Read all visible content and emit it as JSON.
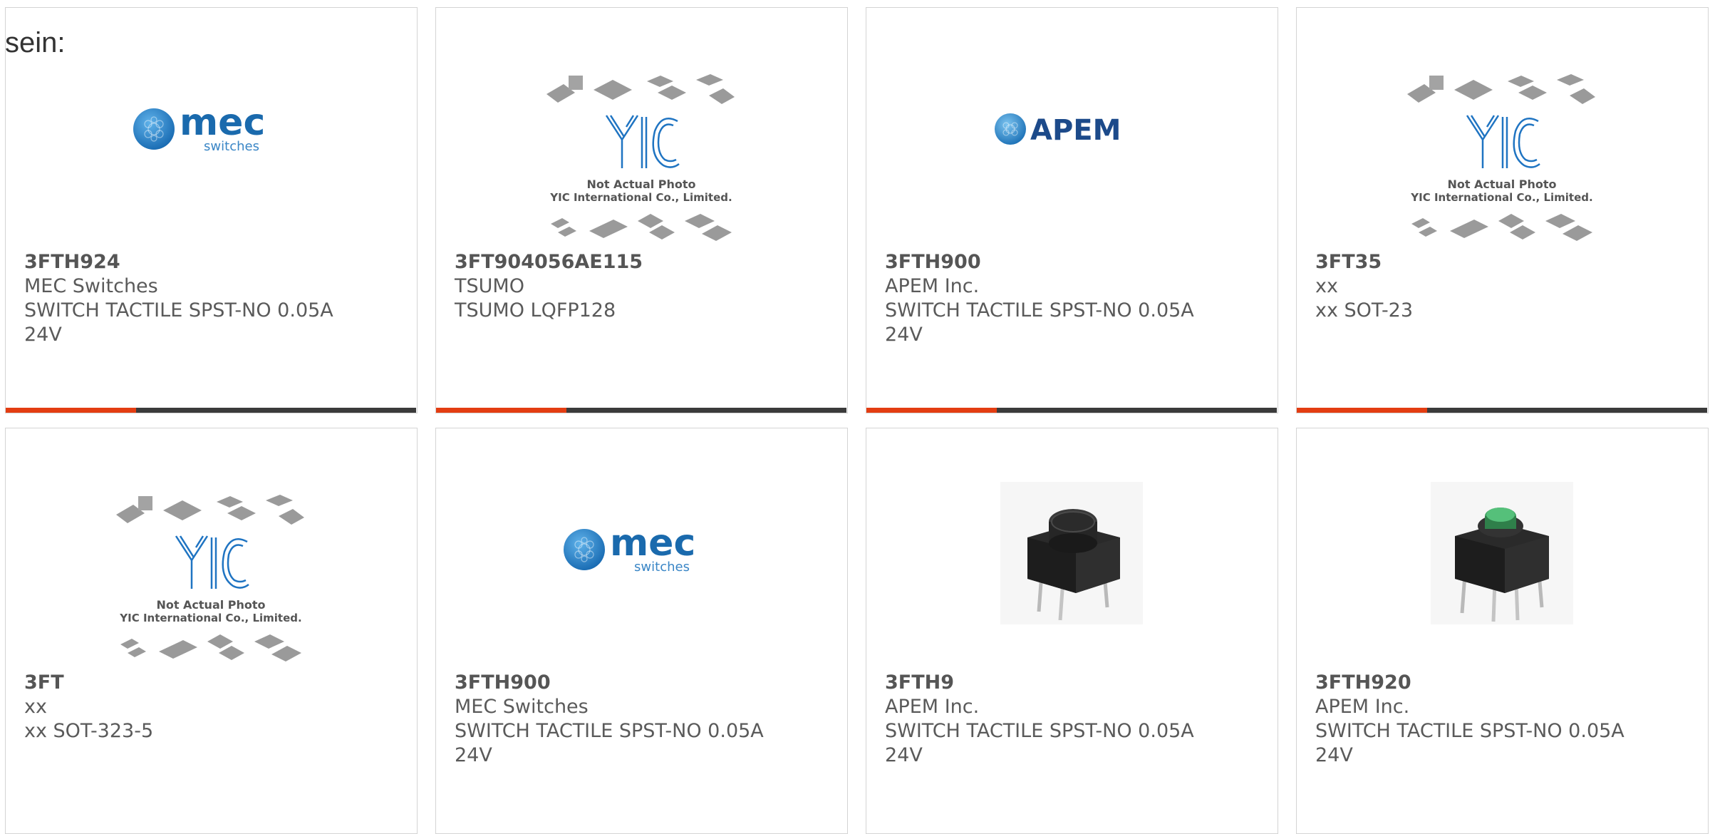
{
  "intro_text": "sein:",
  "colors": {
    "accent_bar": "#e33d12",
    "dark_bar": "#3b3b3b",
    "brand_blue": "#1976c0"
  },
  "logos": {
    "mec_word": "mec",
    "mec_sub": "switches",
    "apem_word": "APEM",
    "yic_letters": "YIC",
    "yic_line1": "Not Actual Photo",
    "yic_line2": "YIC International Co., Limited."
  },
  "products": [
    {
      "part": "3FTH924",
      "maker": "MEC Switches",
      "desc": "SWITCH TACTILE SPST-NO 0.05A",
      "desc2": "24V",
      "image": "mec-logo"
    },
    {
      "part": "3FT904056AE115",
      "maker": "TSUMO",
      "desc": "TSUMO LQFP128",
      "desc2": "",
      "image": "yic-placeholder"
    },
    {
      "part": "3FTH900",
      "maker": "APEM Inc.",
      "desc": "SWITCH TACTILE SPST-NO 0.05A",
      "desc2": "24V",
      "image": "apem-logo"
    },
    {
      "part": "3FT35",
      "maker": "xx",
      "desc": "xx SOT-23",
      "desc2": "",
      "image": "yic-placeholder"
    },
    {
      "part": "3FT",
      "maker": "xx",
      "desc": "xx SOT-323-5",
      "desc2": "",
      "image": "yic-placeholder"
    },
    {
      "part": "3FTH900",
      "maker": "MEC Switches",
      "desc": "SWITCH TACTILE SPST-NO 0.05A",
      "desc2": "24V",
      "image": "mec-logo"
    },
    {
      "part": "3FTH9",
      "maker": "APEM Inc.",
      "desc": "SWITCH TACTILE SPST-NO 0.05A",
      "desc2": "24V",
      "image": "black-tactile-switch-photo"
    },
    {
      "part": "3FTH920",
      "maker": "APEM Inc.",
      "desc": "SWITCH TACTILE SPST-NO 0.05A",
      "desc2": "24V",
      "image": "green-tactile-switch-photo"
    }
  ]
}
